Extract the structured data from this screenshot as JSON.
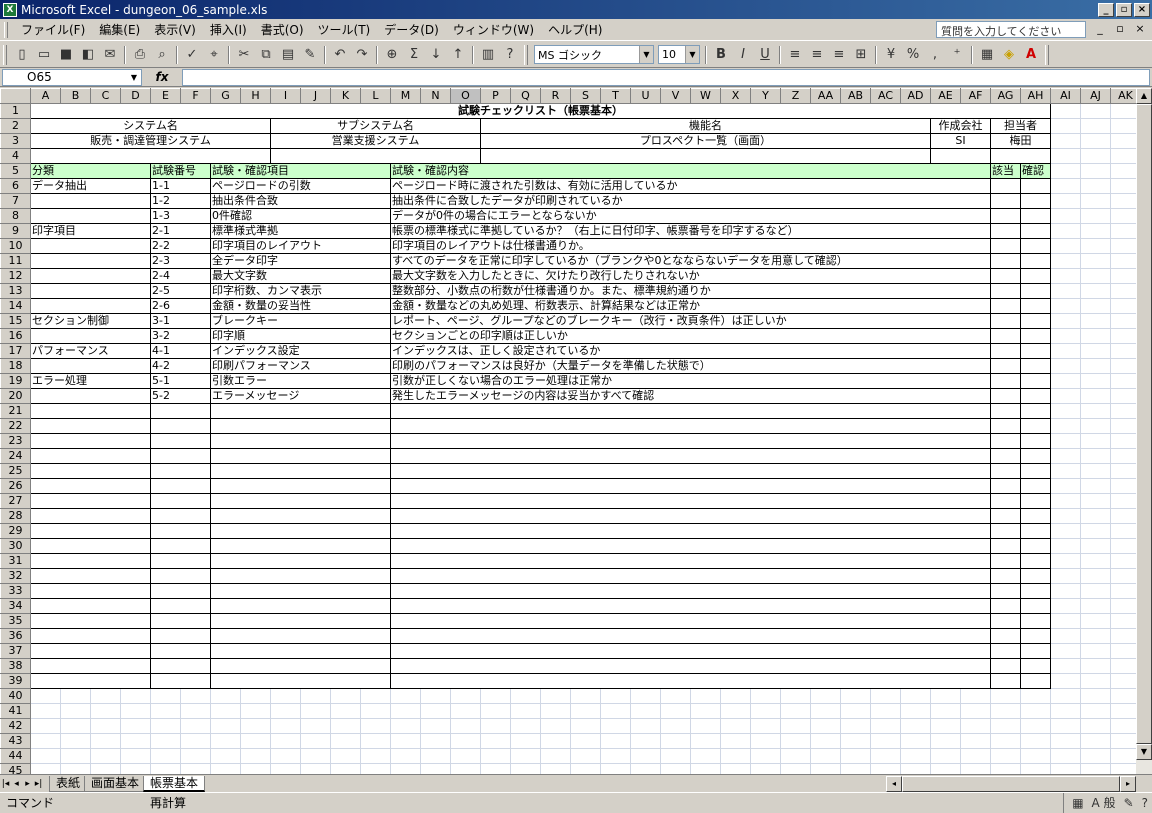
{
  "window": {
    "title": "Microsoft Excel - dungeon_06_sample.xls"
  },
  "menu": [
    "ファイル(F)",
    "編集(E)",
    "表示(V)",
    "挿入(I)",
    "書式(O)",
    "ツール(T)",
    "データ(D)",
    "ウィンドウ(W)",
    "ヘルプ(H)"
  ],
  "help_placeholder": "質問を入力してください",
  "toolbar": {
    "font": "MS ゴシック",
    "size": "10"
  },
  "namebox": "O65",
  "columns": [
    "A",
    "B",
    "C",
    "D",
    "E",
    "F",
    "G",
    "H",
    "I",
    "J",
    "K",
    "L",
    "M",
    "N",
    "O",
    "P",
    "Q",
    "R",
    "S",
    "T",
    "U",
    "V",
    "W",
    "X",
    "Y",
    "Z",
    "AA",
    "AB",
    "AC",
    "AD",
    "AE",
    "AF",
    "AG",
    "AH",
    "AI",
    "AJ",
    "AK"
  ],
  "sheet": {
    "title": "試験チェックリスト（帳票基本）",
    "hdr_system": "システム名",
    "hdr_subsystem": "サブシステム名",
    "hdr_function": "機能名",
    "hdr_company": "作成会社",
    "hdr_owner": "担当者",
    "val_system": "販売・調達管理システム",
    "val_subsystem": "営業支援システム",
    "val_function": "プロスペクト一覧（画面）",
    "val_company": "SI",
    "val_owner": "梅田",
    "col_category": "分類",
    "col_no": "試験番号",
    "col_item": "試験・確認項目",
    "col_content": "試験・確認内容",
    "col_applicable": "該当",
    "col_check": "確認",
    "rows": [
      {
        "cat": "データ抽出",
        "no": "1-1",
        "item": "ページロードの引数",
        "content": "ページロード時に渡された引数は、有効に活用しているか"
      },
      {
        "cat": "",
        "no": "1-2",
        "item": "抽出条件合致",
        "content": "抽出条件に合致したデータが印刷されているか"
      },
      {
        "cat": "",
        "no": "1-3",
        "item": "0件確認",
        "content": "データが0件の場合にエラーとならないか"
      },
      {
        "cat": "印字項目",
        "no": "2-1",
        "item": "標準様式準拠",
        "content": "帳票の標準様式に準拠しているか？（右上に日付印字、帳票番号を印字するなど）"
      },
      {
        "cat": "",
        "no": "2-2",
        "item": "印字項目のレイアウト",
        "content": "印字項目のレイアウトは仕様書通りか。"
      },
      {
        "cat": "",
        "no": "2-3",
        "item": "全データ印字",
        "content": "すべてのデータを正常に印字しているか（ブランクや0となならないデータを用意して確認）"
      },
      {
        "cat": "",
        "no": "2-4",
        "item": "最大文字数",
        "content": "最大文字数を入力したときに、欠けたり改行したりされないか"
      },
      {
        "cat": "",
        "no": "2-5",
        "item": "印字桁数、カンマ表示",
        "content": "整数部分、小数点の桁数が仕様書通りか。また、標準規約通りか"
      },
      {
        "cat": "",
        "no": "2-6",
        "item": "金額・数量の妥当性",
        "content": "金額・数量などの丸め処理、桁数表示、計算結果などは正常か"
      },
      {
        "cat": "セクション制御",
        "no": "3-1",
        "item": "ブレークキー",
        "content": "レポート、ページ、グループなどのブレークキー（改行・改頁条件）は正しいか"
      },
      {
        "cat": "",
        "no": "3-2",
        "item": "印字順",
        "content": "セクションごとの印字順は正しいか"
      },
      {
        "cat": "パフォーマンス",
        "no": "4-1",
        "item": "インデックス設定",
        "content": "インデックスは、正しく設定されているか"
      },
      {
        "cat": "",
        "no": "4-2",
        "item": "印刷パフォーマンス",
        "content": "印刷のパフォーマンスは良好か（大量データを準備した状態で）"
      },
      {
        "cat": "エラー処理",
        "no": "5-1",
        "item": "引数エラー",
        "content": "引数が正しくない場合のエラー処理は正常か"
      },
      {
        "cat": "",
        "no": "5-2",
        "item": "エラーメッセージ",
        "content": "発生したエラーメッセージの内容は妥当かすべて確認"
      }
    ]
  },
  "tabs": [
    "表紙",
    "画面基本",
    "帳票基本"
  ],
  "status": {
    "mode": "コマンド",
    "calc": "再計算",
    "ime": "A 般"
  }
}
